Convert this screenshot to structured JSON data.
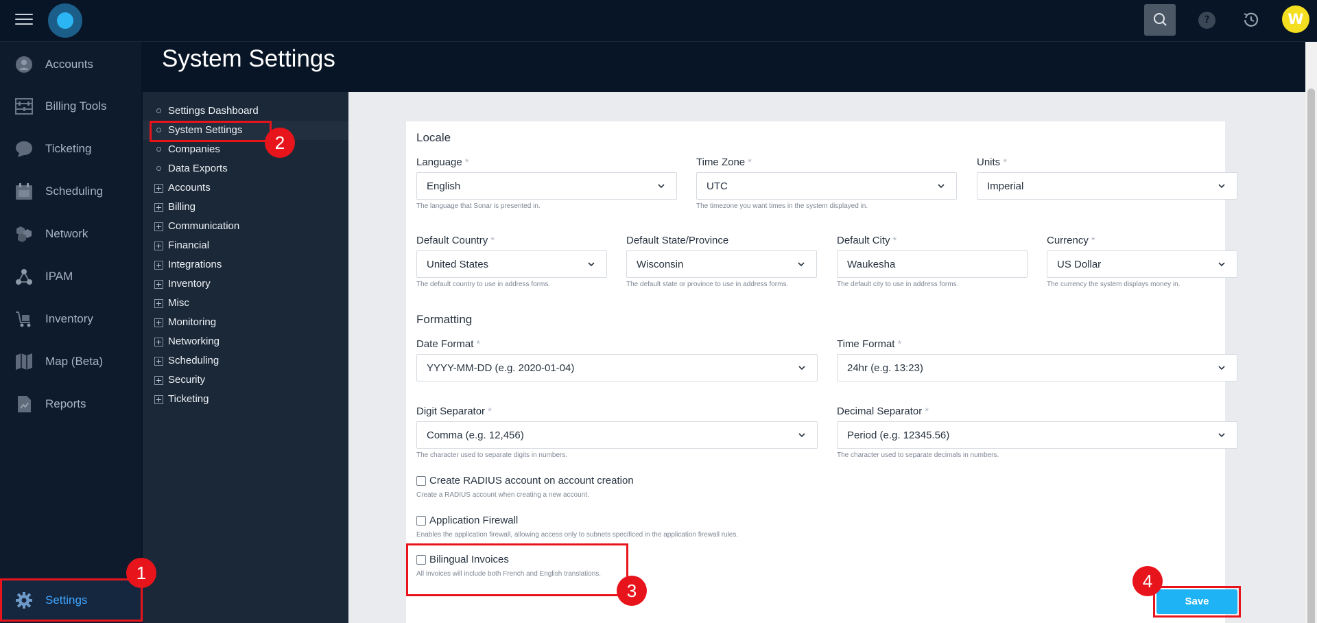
{
  "topbar": {
    "avatar_initial": "W",
    "help_label": "?",
    "icons": {
      "menu": "hamburger-icon",
      "logo": "app-logo",
      "search": "search-icon",
      "help": "help-icon",
      "history": "history-icon"
    }
  },
  "sidebar": {
    "items": [
      {
        "label": "Accounts",
        "icon": "user-circle-icon"
      },
      {
        "label": "Billing Tools",
        "icon": "abacus-icon"
      },
      {
        "label": "Ticketing",
        "icon": "chat-bubble-icon"
      },
      {
        "label": "Scheduling",
        "icon": "calendar-icon"
      },
      {
        "label": "Network",
        "icon": "network-icon"
      },
      {
        "label": "IPAM",
        "icon": "ipam-icon"
      },
      {
        "label": "Inventory",
        "icon": "cart-icon"
      },
      {
        "label": "Map (Beta)",
        "icon": "map-icon"
      },
      {
        "label": "Reports",
        "icon": "report-icon"
      }
    ],
    "settings": {
      "label": "Settings",
      "icon": "gear-icon"
    }
  },
  "page": {
    "title": "System Settings"
  },
  "subnav": {
    "items": [
      {
        "label": "Settings Dashboard",
        "type": "leaf"
      },
      {
        "label": "System Settings",
        "type": "leaf",
        "active": true
      },
      {
        "label": "Companies",
        "type": "leaf"
      },
      {
        "label": "Data Exports",
        "type": "leaf"
      },
      {
        "label": "Accounts",
        "type": "group"
      },
      {
        "label": "Billing",
        "type": "group"
      },
      {
        "label": "Communication",
        "type": "group"
      },
      {
        "label": "Financial",
        "type": "group"
      },
      {
        "label": "Integrations",
        "type": "group"
      },
      {
        "label": "Inventory",
        "type": "group"
      },
      {
        "label": "Misc",
        "type": "group"
      },
      {
        "label": "Monitoring",
        "type": "group"
      },
      {
        "label": "Networking",
        "type": "group"
      },
      {
        "label": "Scheduling",
        "type": "group"
      },
      {
        "label": "Security",
        "type": "group"
      },
      {
        "label": "Ticketing",
        "type": "group"
      }
    ]
  },
  "form": {
    "locale_title": "Locale",
    "formatting_title": "Formatting",
    "required_mark": "*",
    "language": {
      "label": "Language",
      "value": "English",
      "help": "The language that Sonar is presented in."
    },
    "timezone": {
      "label": "Time Zone",
      "value": "UTC",
      "help": "The timezone you want times in the system displayed in."
    },
    "units": {
      "label": "Units",
      "value": "Imperial"
    },
    "country": {
      "label": "Default Country",
      "value": "United States",
      "help": "The default country to use in address forms."
    },
    "state": {
      "label": "Default State/Province",
      "value": "Wisconsin",
      "help": "The default state or province to use in address forms."
    },
    "city": {
      "label": "Default City",
      "value": "Waukesha",
      "help": "The default city to use in address forms."
    },
    "currency": {
      "label": "Currency",
      "value": "US Dollar",
      "help": "The currency the system displays money in."
    },
    "date_format": {
      "label": "Date Format",
      "value": "YYYY-MM-DD (e.g. 2020-01-04)"
    },
    "time_format": {
      "label": "Time Format",
      "value": "24hr (e.g. 13:23)"
    },
    "digit_sep": {
      "label": "Digit Separator",
      "value": "Comma (e.g. 12,456)",
      "help": "The character used to separate digits in numbers."
    },
    "decimal_sep": {
      "label": "Decimal Separator",
      "value": "Period (e.g. 12345.56)",
      "help": "The character used to separate decimals in numbers."
    },
    "radius": {
      "label": "Create RADIUS account on account creation",
      "help": "Create a RADIUS account when creating a new account.",
      "checked": false
    },
    "firewall": {
      "label": "Application Firewall",
      "help": "Enables the application firewall, allowing access only to subnets specificed in the application firewall rules.",
      "checked": false
    },
    "bilingual": {
      "label": "Bilingual Invoices",
      "help": "All invoices will include both French and English translations.",
      "checked": false
    },
    "save_label": "Save"
  },
  "annotations": {
    "one": "1",
    "two": "2",
    "three": "3",
    "four": "4"
  },
  "colors": {
    "accent": "#1eb3f4",
    "highlight": "#e8141b",
    "nav_bg": "#0d1b2d",
    "active_nav_text": "#3fa5ff"
  }
}
